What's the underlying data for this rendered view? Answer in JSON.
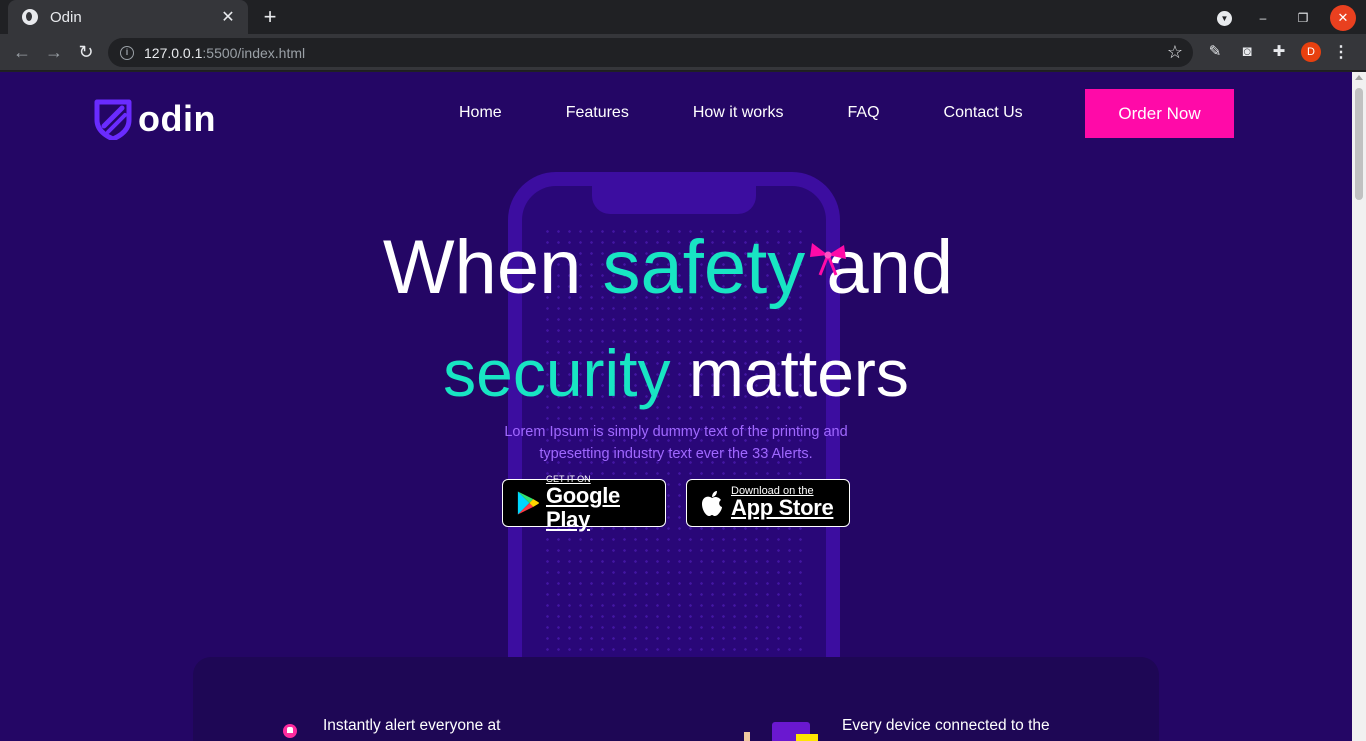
{
  "browser": {
    "tab_title": "Odin",
    "url_host": "127.0.0.1",
    "url_rest": ":5500/index.html",
    "profile_initial": "D"
  },
  "site": {
    "logo_text": "odin",
    "nav": [
      "Home",
      "Features",
      "How it works",
      "FAQ",
      "Contact Us"
    ],
    "cta": "Order Now"
  },
  "hero": {
    "line1_pre": "When",
    "line1_accent": "safety",
    "line1_post": "and",
    "line2_accent": "security",
    "line2_post": "matters",
    "description": "Lorem Ipsum is simply dummy text of the printing and typesetting industry text ever the 33 Alerts.",
    "google_small": "GET IT ON",
    "google_big": "Google Play",
    "apple_small": "Download on the",
    "apple_big": "App Store"
  },
  "features": {
    "left_text": "Instantly alert everyone at",
    "right_text": "Every device connected to the"
  },
  "colors": {
    "page_bg": "#240665",
    "accent_teal": "#18e5c3",
    "cta_pink": "#ff0aa8",
    "desc_purple": "#a068ff"
  }
}
